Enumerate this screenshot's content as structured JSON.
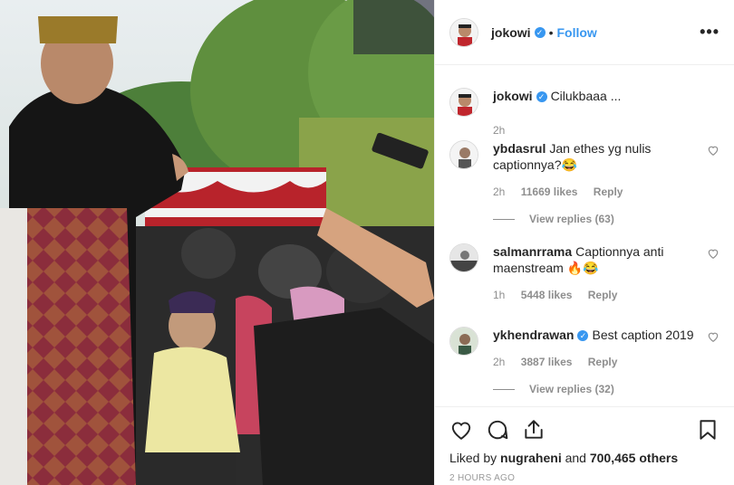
{
  "header": {
    "username": "jokowi",
    "follow_label": "Follow",
    "dot": "•",
    "more_label": "•••"
  },
  "caption": {
    "username": "jokowi",
    "text": "Cilukbaaa ...",
    "time": "2h"
  },
  "comments": [
    {
      "username": "ybdasrul",
      "text": "Jan ethes yg nulis captionnya?😂",
      "time": "2h",
      "likes": "11669 likes",
      "reply": "Reply",
      "view_replies": "View replies (63)"
    },
    {
      "username": "salmanrrama",
      "text": "Captionnya anti maenstream 🔥😂",
      "time": "1h",
      "likes": "5448 likes",
      "reply": "Reply"
    },
    {
      "username": "ykhendrawan",
      "text": "Best caption 2019",
      "time": "2h",
      "likes": "3887 likes",
      "reply": "Reply",
      "view_replies": "View replies (32)"
    }
  ],
  "likes": {
    "prefix": "Liked by",
    "user": "nugraheni",
    "and": "and",
    "others": "700,465 others"
  },
  "timestamp": "2 HOURS AGO",
  "colors": {
    "accent": "#3897f0",
    "muted": "#8e8e8e"
  }
}
